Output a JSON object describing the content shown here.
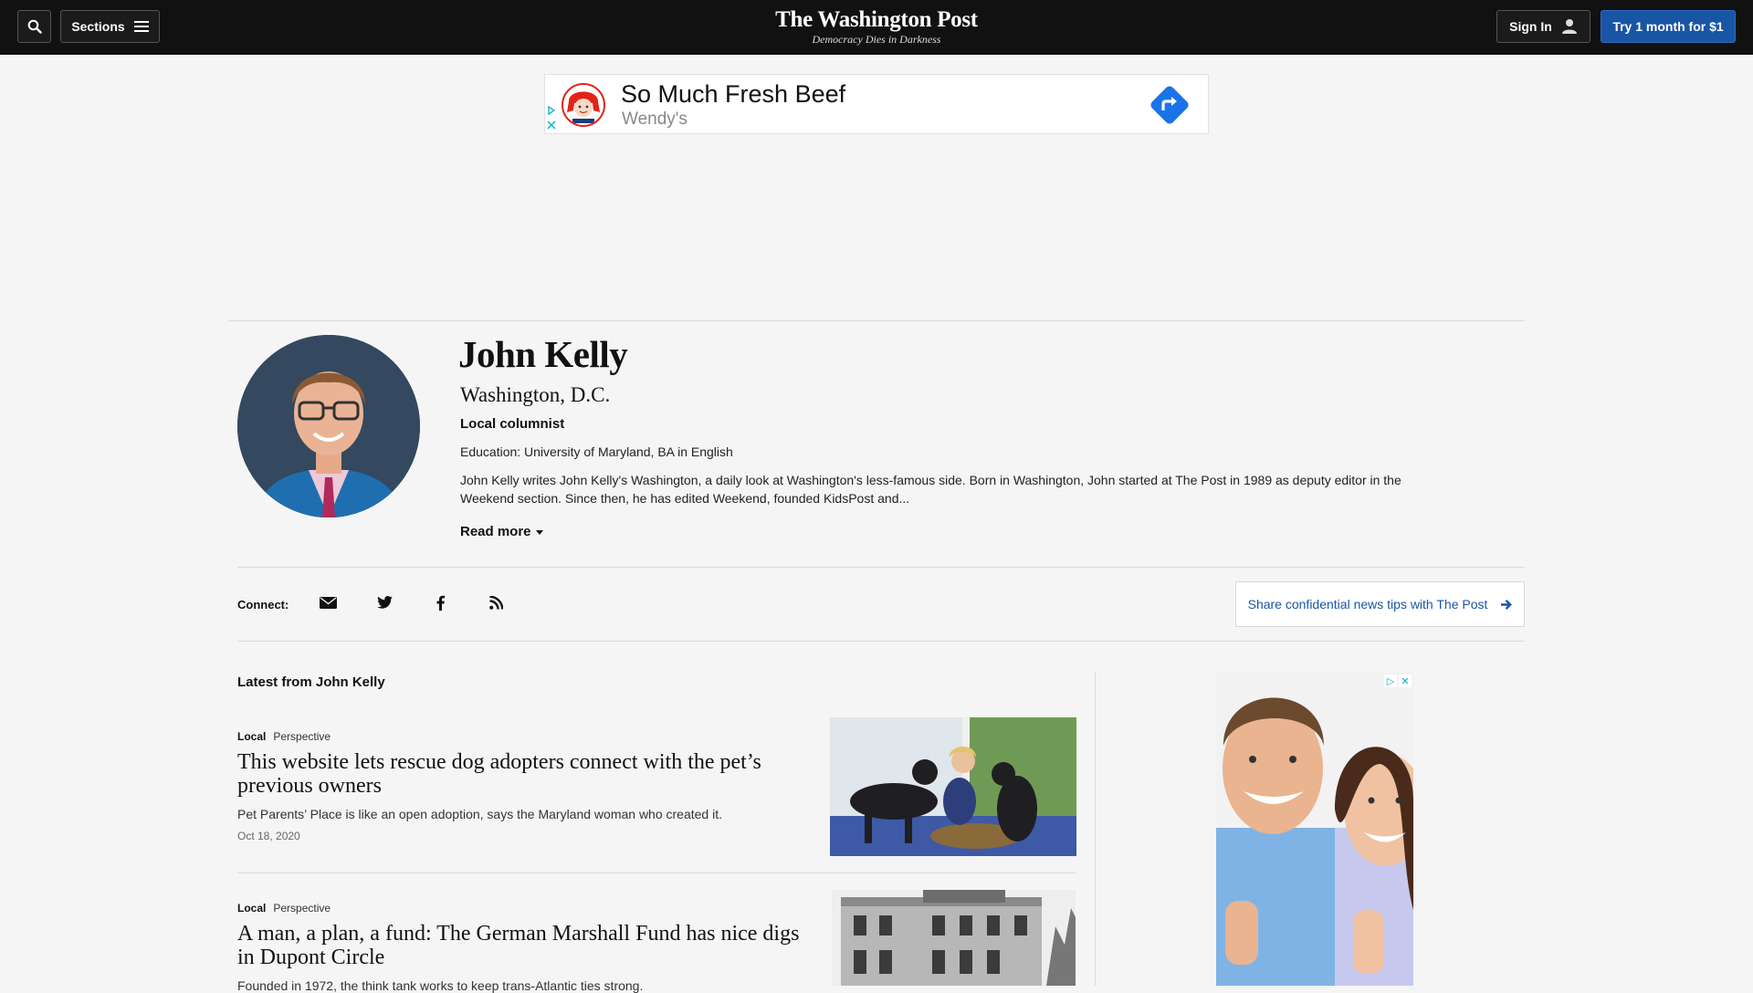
{
  "header": {
    "logo": "The Washington Post",
    "tagline": "Democracy Dies in Darkness",
    "sections_label": "Sections",
    "signin_label": "Sign In",
    "subscribe_label": "Try 1 month for $1",
    "search_icon": "search-icon",
    "menu_icon": "hamburger-icon",
    "user_icon": "person-icon"
  },
  "banner_ad": {
    "headline": "So Much Fresh Beef",
    "brand": "Wendy's",
    "icons": [
      "adchoices-icon",
      "close-icon",
      "directions-icon"
    ]
  },
  "profile": {
    "name": "John Kelly",
    "location": "Washington, D.C.",
    "role": "Local columnist",
    "education": "Education: University of Maryland, BA in English",
    "bio": "John Kelly writes John Kelly's Washington, a daily look at Washington's less-famous side. Born in Washington, John started at The Post in 1989 as deputy editor in the Weekend section. Since then, he has edited Weekend, founded KidsPost and...",
    "read_more": "Read more"
  },
  "connect": {
    "label": "Connect:",
    "icons": [
      "email-icon",
      "twitter-icon",
      "facebook-icon",
      "rss-icon"
    ],
    "tips_label": "Share confidential news tips with The Post"
  },
  "latest": {
    "heading": "Latest from John Kelly",
    "articles": [
      {
        "section": "Local",
        "type": "Perspective",
        "title": "This website lets rescue dog adopters connect with the pet’s previous owners",
        "blurb": "Pet Parents’ Place is like an open adoption, says the Maryland woman who created it.",
        "date": "Oct 18, 2020"
      },
      {
        "section": "Local",
        "type": "Perspective",
        "title": "A man, a plan, a fund: The German Marshall Fund has nice digs in Dupont Circle",
        "blurb": "Founded in 1972, the think tank works to keep trans-Atlantic ties strong.",
        "date": ""
      }
    ]
  },
  "colors": {
    "topbar": "#111111",
    "accent_blue": "#1955a5",
    "page_bg": "#f5f5f5"
  }
}
